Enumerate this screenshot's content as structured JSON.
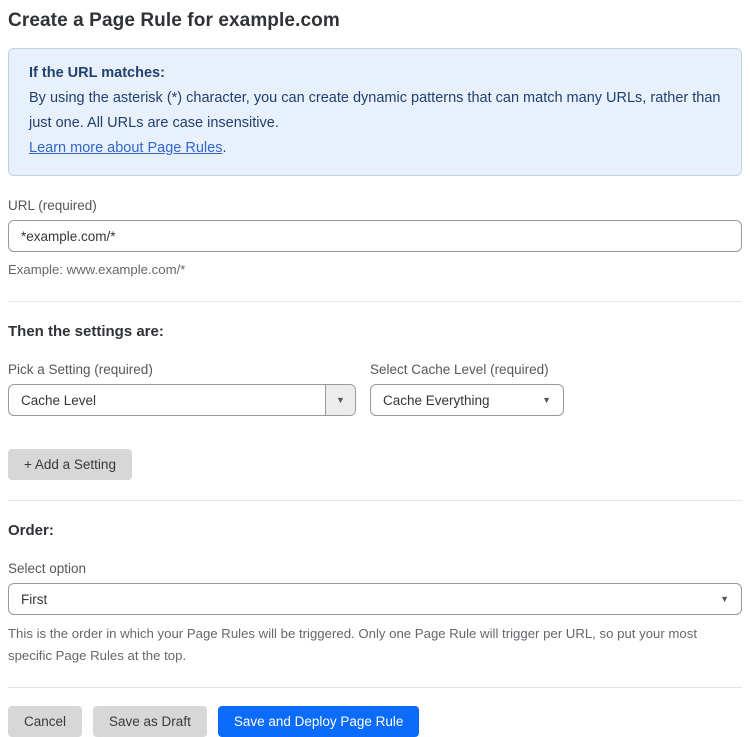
{
  "page": {
    "title": "Create a Page Rule for example.com"
  },
  "info_box": {
    "heading": "If the URL matches:",
    "body": "By using the asterisk (*) character, you can create dynamic patterns that can match many URLs, rather than just one. All URLs are case insensitive.",
    "link_text": "Learn more about Page Rules",
    "link_suffix": "."
  },
  "url_field": {
    "label": "URL (required)",
    "value": "*example.com/*",
    "example": "Example: www.example.com/*"
  },
  "settings": {
    "heading": "Then the settings are:",
    "pick_setting": {
      "label": "Pick a Setting (required)",
      "value": "Cache Level"
    },
    "cache_level": {
      "label": "Select Cache Level (required)",
      "value": "Cache Everything"
    },
    "add_setting_label": "+ Add a Setting"
  },
  "order": {
    "heading": "Order:",
    "label": "Select option",
    "value": "First",
    "help": "This is the order in which your Page Rules will be triggered. Only one Page Rule will trigger per URL, so put your most specific Page Rules at the top."
  },
  "actions": {
    "cancel": "Cancel",
    "save_draft": "Save as Draft",
    "save_deploy": "Save and Deploy Page Rule"
  },
  "colors": {
    "accent_blue": "#0b6cfb",
    "info_bg": "#e8f1fb",
    "info_border": "#b9d4f1",
    "info_text": "#22406f",
    "link_blue": "#3366cc",
    "button_gray": "#d7d7d7"
  }
}
